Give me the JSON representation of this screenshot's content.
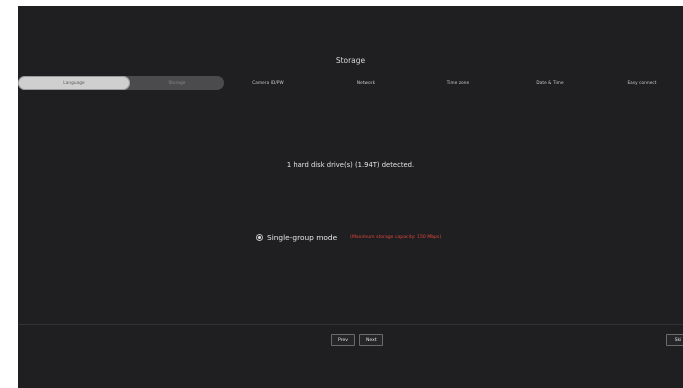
{
  "page_title": "Storage",
  "steps": [
    {
      "label": "Language"
    },
    {
      "label": "Storage"
    },
    {
      "label": "Camera ID/PW"
    },
    {
      "label": "Network"
    },
    {
      "label": "Time zone"
    },
    {
      "label": "Date & Time"
    },
    {
      "label": "Easy connect"
    }
  ],
  "detected_text": "1 hard disk drive(s) (1.94T) detected.",
  "mode": {
    "label": "Single-group mode",
    "note": "(Maximum storage capacity: 150 Mbps)",
    "selected": true
  },
  "buttons": {
    "prev": "Prev",
    "next": "Next",
    "skip": "Ski"
  },
  "colors": {
    "background": "#1f1f21",
    "active_step": "#cfcfcf",
    "note_red": "#e0463c"
  }
}
